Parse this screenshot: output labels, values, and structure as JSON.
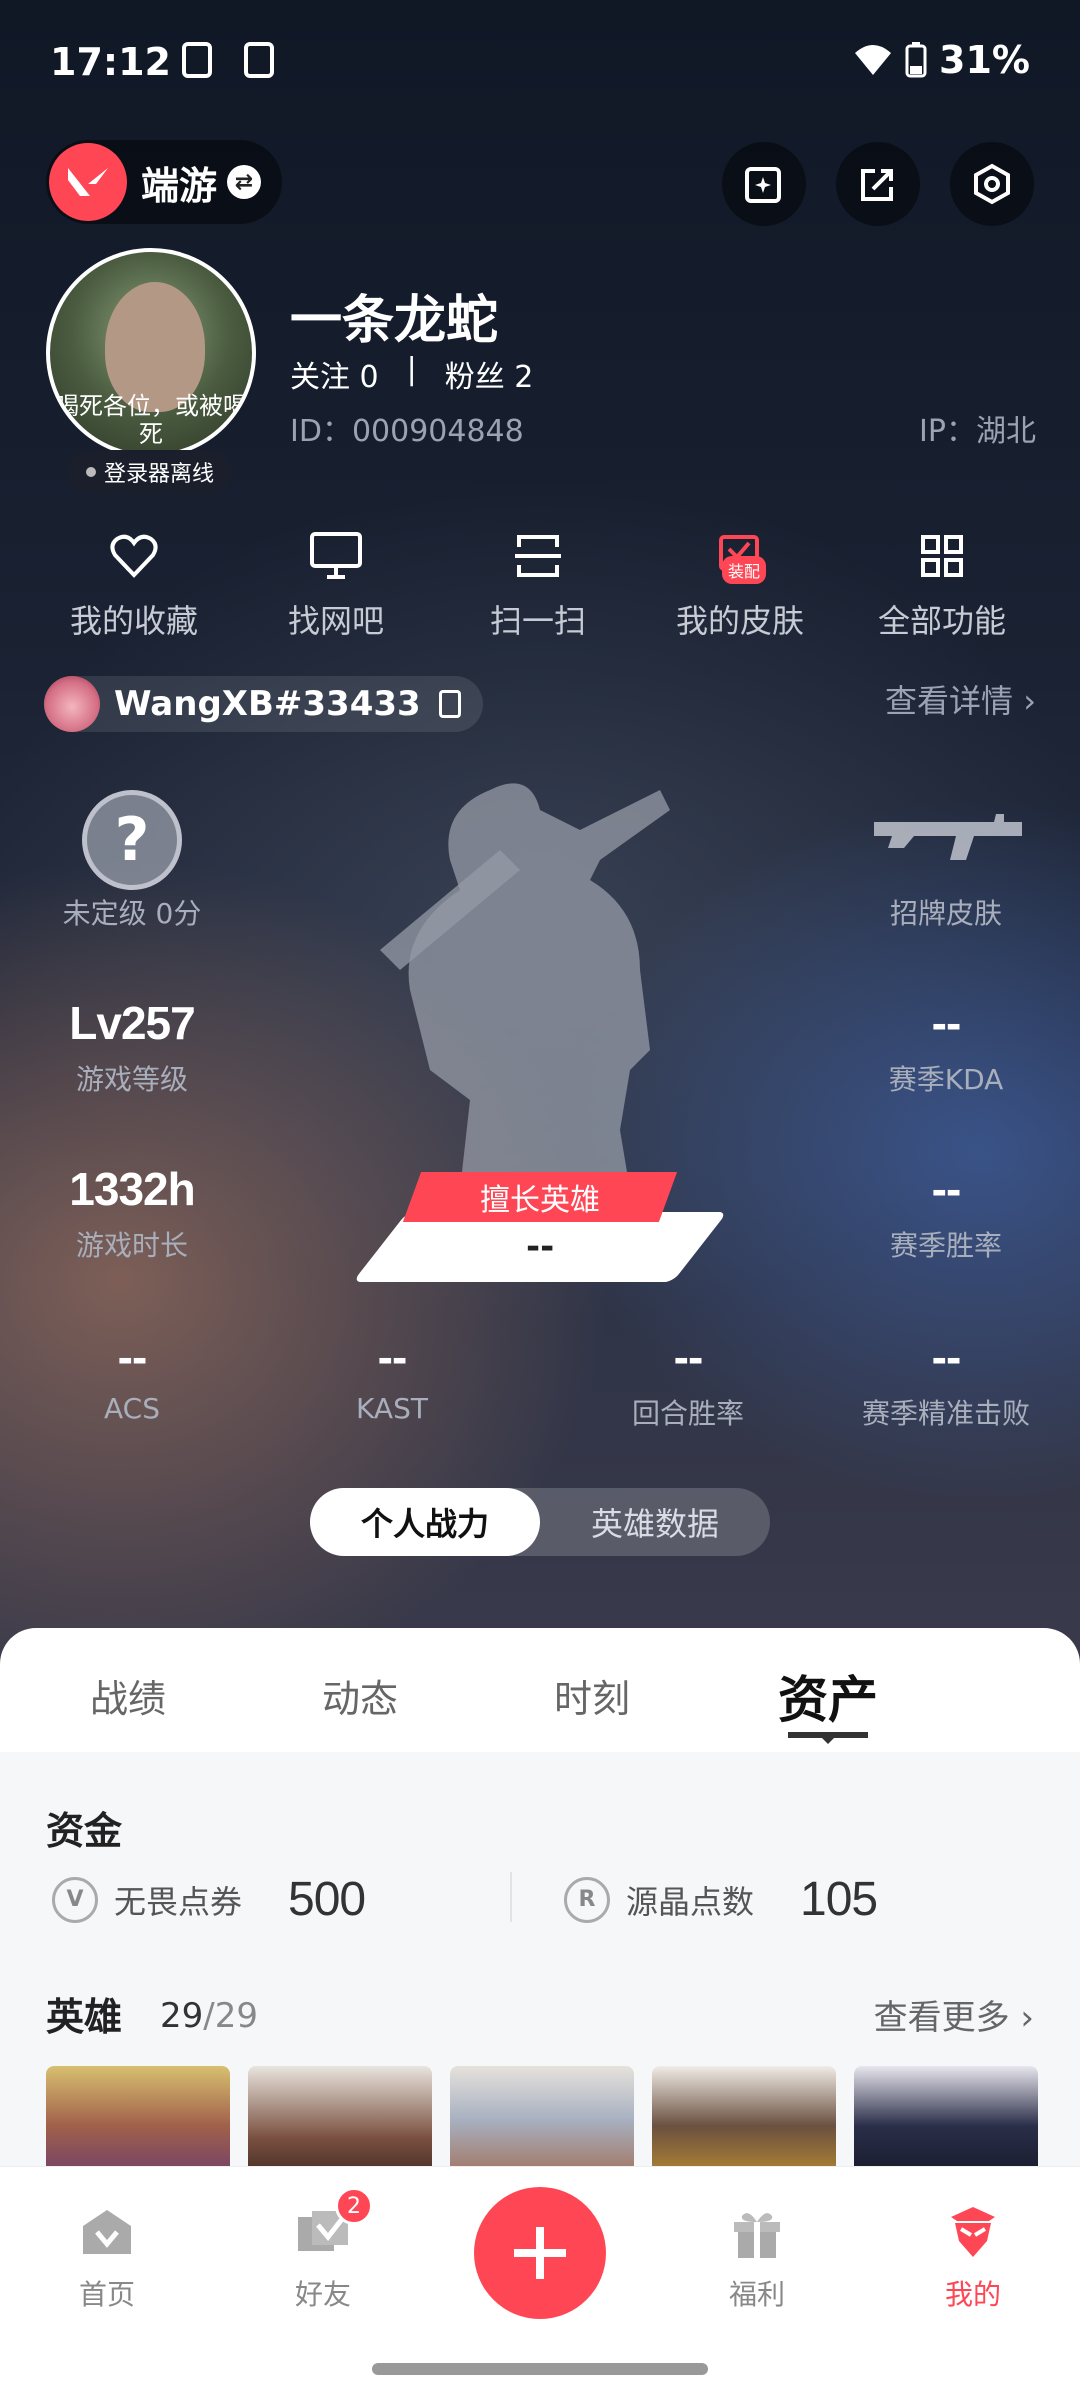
{
  "status_bar": {
    "time": "17:12",
    "battery": "31%"
  },
  "top_bar": {
    "game_name": "端游"
  },
  "profile": {
    "nickname": "一条龙蛇",
    "follow_label": "关注",
    "follow_count": "0",
    "separator": "|",
    "fans_label": "粉丝",
    "fans_count": "2",
    "id": "ID：000904848",
    "ip": "IP：湖北",
    "status": "登录器离线",
    "avatar_text": "喝死各位，或被喝死"
  },
  "functions": [
    {
      "label": "我的收藏",
      "icon": "heart-icon"
    },
    {
      "label": "找网吧",
      "icon": "monitor-icon"
    },
    {
      "label": "扫一扫",
      "icon": "scan-icon"
    },
    {
      "label": "我的皮肤",
      "icon": "skin-icon",
      "badge": "装配"
    },
    {
      "label": "全部功能",
      "icon": "grid-icon"
    }
  ],
  "riot": {
    "name": "WangXB#33433",
    "detail_link": "查看详情 ›"
  },
  "stats": {
    "rank_symbol": "?",
    "rank_label": "未定级 0分",
    "skin_label": "招牌皮肤",
    "level_value": "Lv257",
    "level_label": "游戏等级",
    "kda_value": "--",
    "kda_label": "赛季KDA",
    "time_value": "1332h",
    "time_label": "游戏时长",
    "winrate_value": "--",
    "winrate_label": "赛季胜率",
    "best_hero_label": "擅长英雄",
    "best_hero_value": "--",
    "bottom": [
      {
        "value": "--",
        "label": "ACS"
      },
      {
        "value": "--",
        "label": "KAST"
      },
      {
        "value": "--",
        "label": "回合胜率"
      },
      {
        "value": "--",
        "label": "赛季精准击败"
      }
    ]
  },
  "segment": {
    "items": [
      "个人战力",
      "英雄数据"
    ],
    "active": 0
  },
  "tabs": {
    "items": [
      "战绩",
      "动态",
      "时刻",
      "资产"
    ],
    "active": 3
  },
  "assets": {
    "funds_title": "资金",
    "vp_label": "无畏点券",
    "vp_value": "500",
    "rp_label": "源晶点数",
    "rp_value": "105",
    "heroes_title": "英雄",
    "heroes_count": "29",
    "heroes_total": "/29",
    "more": "查看更多 ›"
  },
  "nav": [
    {
      "label": "首页",
      "icon": "home-icon"
    },
    {
      "label": "好友",
      "icon": "friends-icon",
      "badge": "2"
    },
    {
      "label": "",
      "icon": "plus-icon"
    },
    {
      "label": "福利",
      "icon": "gift-icon"
    },
    {
      "label": "我的",
      "icon": "profile-icon"
    }
  ],
  "colors": {
    "accent": "#ff4655",
    "bg_dark": "#1b2230"
  }
}
